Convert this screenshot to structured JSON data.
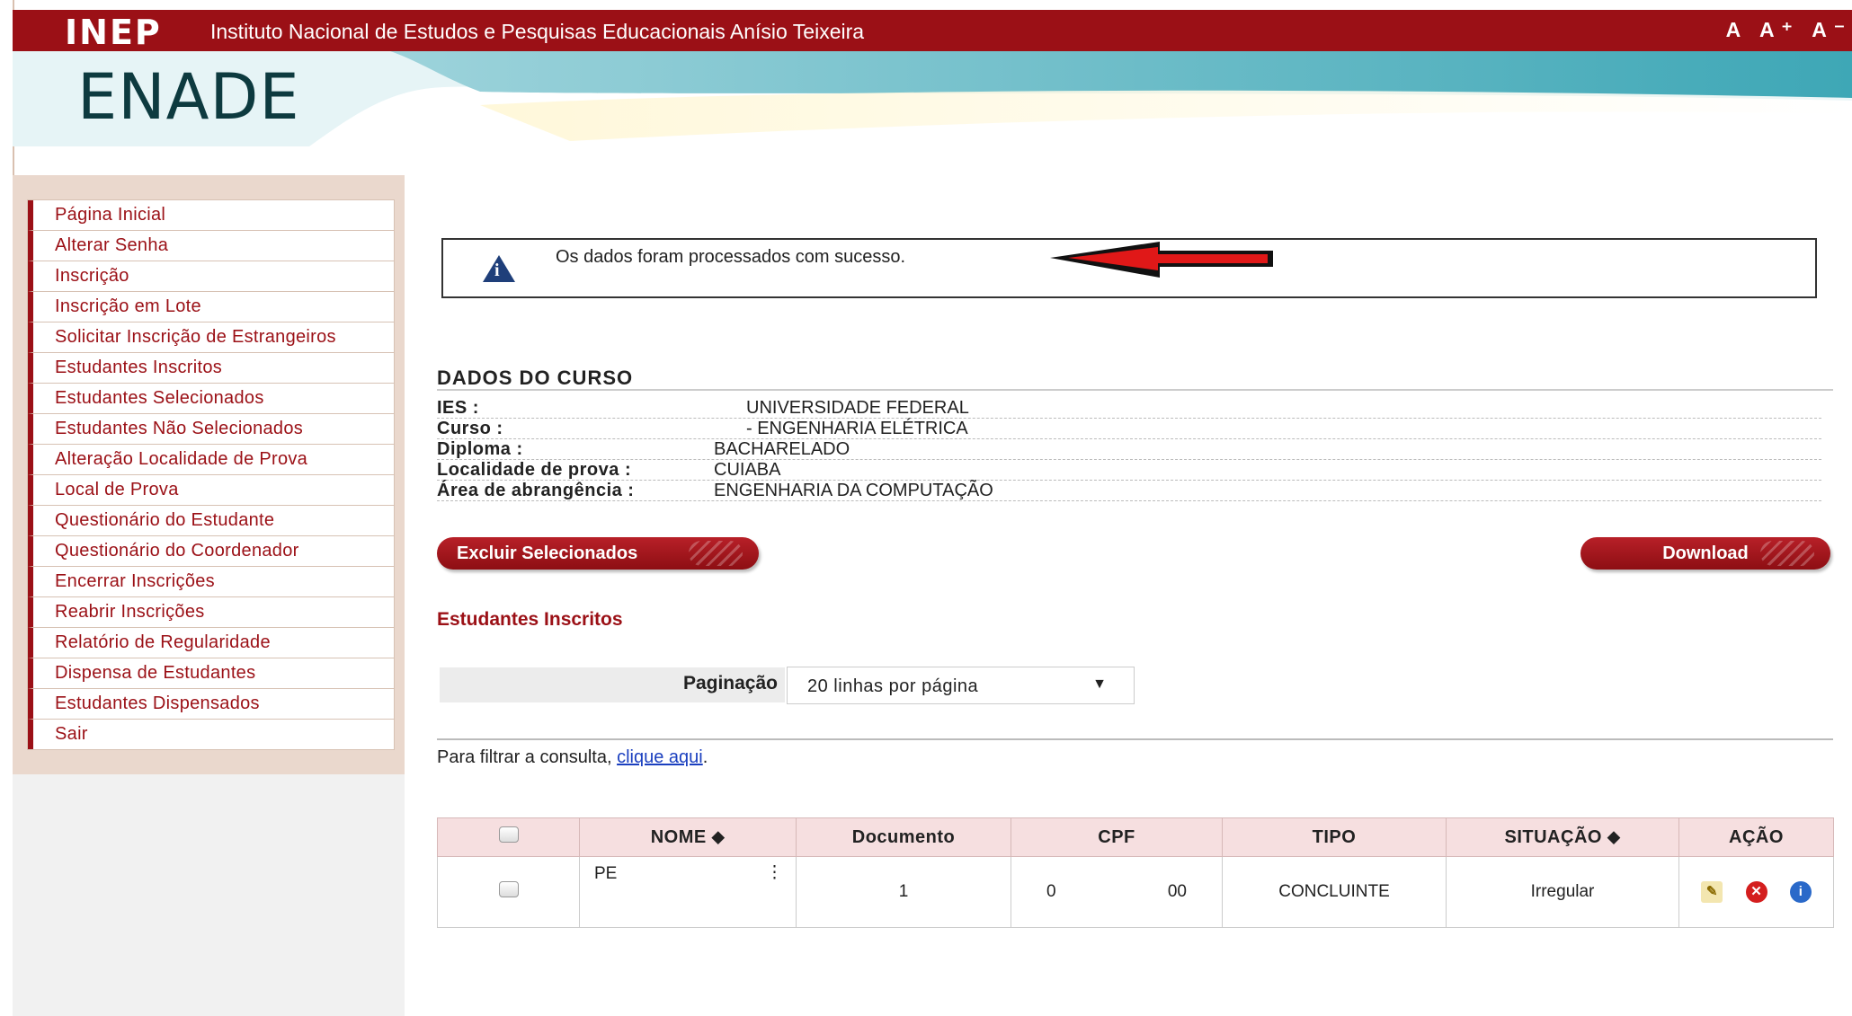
{
  "header": {
    "logo": "INEP",
    "institute": "Instituto Nacional de Estudos e Pesquisas Educacionais Anísio Teixeira",
    "font_controls": "A A⁺ A⁻",
    "app_title": "ENADE"
  },
  "menu": [
    "Página Inicial",
    "Alterar Senha",
    "Inscrição",
    "Inscrição em Lote",
    "Solicitar Inscrição de Estrangeiros",
    "Estudantes Inscritos",
    "Estudantes Selecionados",
    "Estudantes Não Selecionados",
    "Alteração Localidade de Prova",
    "Local de Prova",
    "Questionário do Estudante",
    "Questionário do Coordenador",
    "Encerrar Inscrições",
    "Reabrir Inscrições",
    "Relatório de Regularidade",
    "Dispensa de Estudantes",
    "Estudantes Dispensados",
    "Sair"
  ],
  "message": {
    "text": "Os dados foram processados com sucesso."
  },
  "course": {
    "title": "DADOS DO CURSO",
    "rows": [
      {
        "label": "IES :",
        "value": "UNIVERSIDADE FEDERAL"
      },
      {
        "label": "Curso :",
        "value": "- ENGENHARIA ELÉTRICA"
      },
      {
        "label": "Diploma :",
        "value": "BACHARELADO"
      },
      {
        "label": "Localidade de prova :",
        "value": "CUIABA"
      },
      {
        "label": "Área de abrangência :",
        "value": "ENGENHARIA DA COMPUTAÇÃO"
      }
    ]
  },
  "buttons": {
    "delete_selected": "Excluir Selecionados",
    "download": "Download"
  },
  "students": {
    "title": "Estudantes Inscritos",
    "pagination_label": "Paginação",
    "pagination_value": "20 linhas por página",
    "filter_prefix": "Para filtrar a consulta, ",
    "filter_link": "clique aqui",
    "filter_suffix": ".",
    "columns": [
      "NOME ⬥",
      "Documento",
      "CPF",
      "TIPO",
      "SITUAÇÃO ⬥",
      "AÇÃO"
    ],
    "rows": [
      {
        "nome": "PE",
        "documento": "1",
        "cpf_a": "0",
        "cpf_b": "00",
        "tipo": "CONCLUINTE",
        "situacao": "Irregular"
      }
    ]
  },
  "colors": {
    "brand_red": "#9b1016",
    "banner_teal": "#5fb8c4",
    "link_blue": "#1a3fbf"
  }
}
